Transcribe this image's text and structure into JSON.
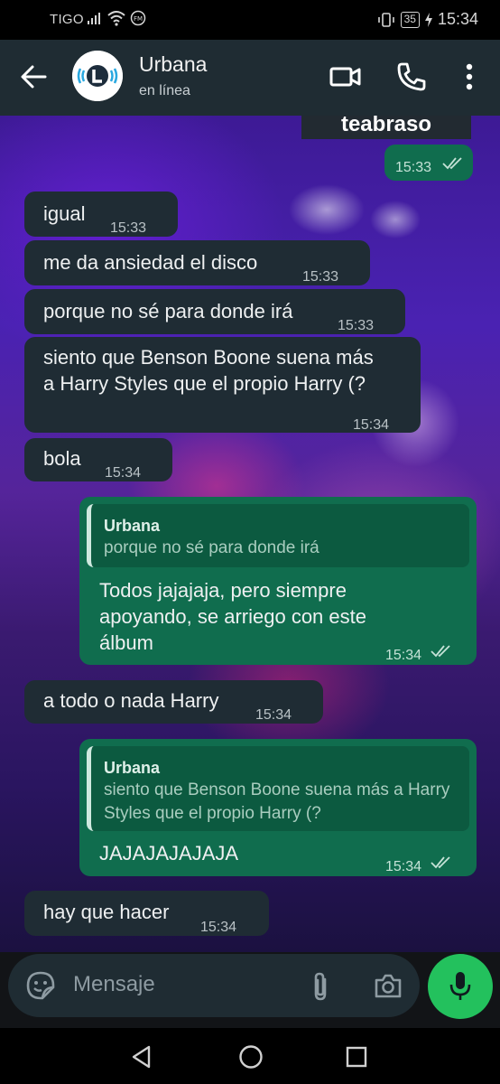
{
  "status_bar": {
    "carrier": "TIGO",
    "battery": "35",
    "time": "15:34"
  },
  "header": {
    "contact_name": "Urbana",
    "contact_status": "en línea",
    "icons": [
      "back-arrow-icon",
      "video-call-icon",
      "phone-icon",
      "more-options-icon"
    ]
  },
  "chat": {
    "top_caption": "teabraso",
    "messages": [
      {
        "dir": "out",
        "text": "",
        "time": "15:33"
      },
      {
        "dir": "in",
        "text": "igual",
        "time": "15:33"
      },
      {
        "dir": "in",
        "text": "me da ansiedad el disco",
        "time": "15:33"
      },
      {
        "dir": "in",
        "text": "porque no sé para donde irá",
        "time": "15:33"
      },
      {
        "dir": "in",
        "text": "siento que Benson Boone suena más a Harry Styles que el propio Harry (?",
        "time": "15:34"
      },
      {
        "dir": "in",
        "text": "bola",
        "time": "15:34"
      },
      {
        "dir": "out",
        "quote_name": "Urbana",
        "quote_text": "porque no sé para donde irá",
        "text": "Todos jajajaja, pero siempre apoyando, se arriego con este álbum",
        "time": "15:34"
      },
      {
        "dir": "in",
        "text": "a todo o nada Harry",
        "time": "15:34"
      },
      {
        "dir": "out",
        "quote_name": "Urbana",
        "quote_text": "siento que Benson Boone suena más a Harry Styles que el propio Harry (?",
        "text": "JAJAJAJAJAJA",
        "time": "15:34"
      },
      {
        "dir": "in",
        "text": "hay que hacer",
        "time": "15:34"
      }
    ]
  },
  "input": {
    "placeholder": "Mensaje"
  },
  "colors": {
    "header_bg": "#1f2c33",
    "incoming_bubble": "#1f2c34",
    "outgoing_bubble": "#106d4e",
    "mic_button": "#23c15d"
  }
}
